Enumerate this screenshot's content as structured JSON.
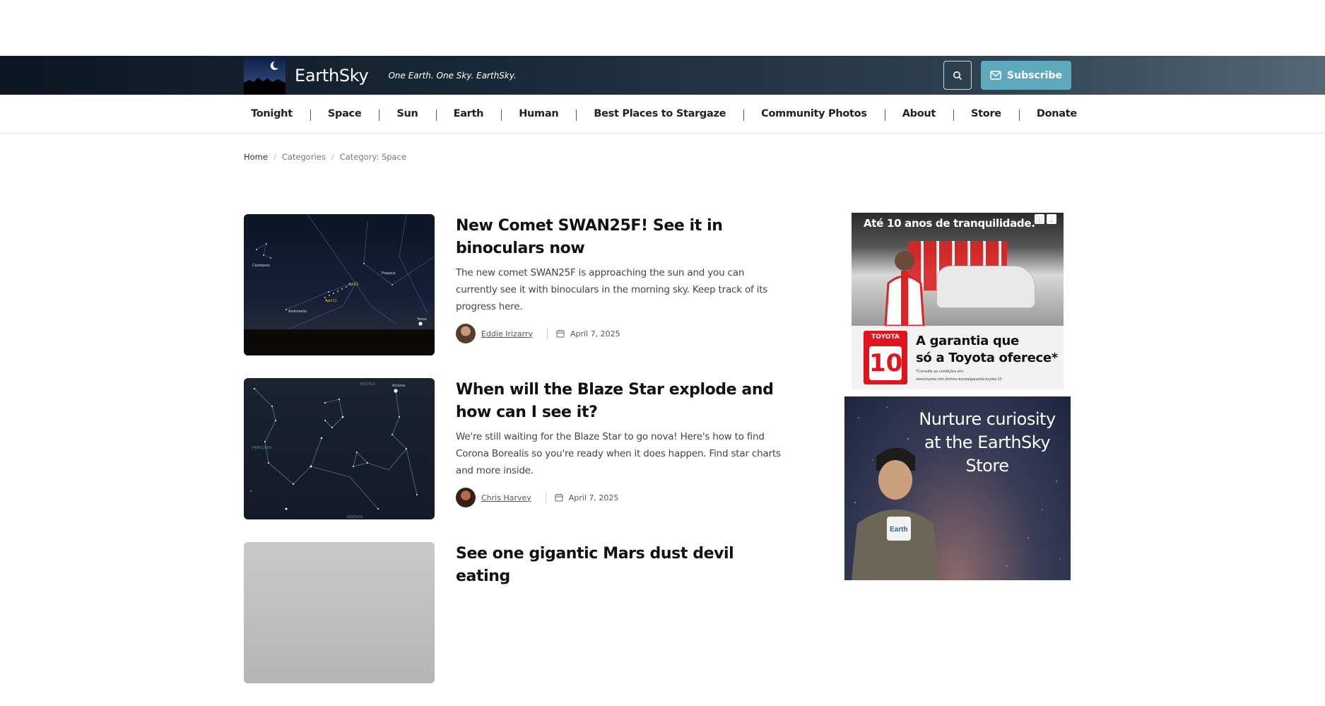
{
  "header": {
    "site_name": "EarthSky",
    "tagline": "One Earth. One Sky. EarthSky.",
    "subscribe_label": "Subscribe"
  },
  "nav": {
    "items": [
      "Tonight",
      "Space",
      "Sun",
      "Earth",
      "Human",
      "Best Places to Stargaze",
      "Community Photos",
      "About",
      "Store",
      "Donate"
    ]
  },
  "breadcrumb": {
    "home": "Home",
    "categories": "Categories",
    "current": "Category: Space"
  },
  "posts": [
    {
      "title": "New Comet SWAN25F! See it in binoculars now",
      "excerpt": "The new comet SWAN25F is approaching the sun and you can currently see it with binoculars in the morning sky. Keep track of its progress here.",
      "author": "Eddie Irizarry",
      "date": "April 7, 2025"
    },
    {
      "title": "When will the Blaze Star explode and how can I see it?",
      "excerpt": "We're still waiting for the Blaze Star to go nova! Here's how to find Corona Borealis so you're ready when it does happen. Find star charts and more inside.",
      "author": "Chris Harvey",
      "date": "April 7, 2025"
    },
    {
      "title": "See one gigantic Mars dust devil eating",
      "excerpt": "",
      "author": "",
      "date": ""
    }
  ],
  "thumb1_labels": {
    "cassiopeia": "Cassiopeia",
    "pegasus": "Pegasus",
    "andromeda": "Andromeda",
    "april6": "April 6",
    "april11": "April 11",
    "venus": "Venus"
  },
  "thumb2_labels": {
    "bootes": "BOOTES",
    "arcturus": "Arcturus",
    "hercules": "HERCULES",
    "serpens": "SERPENS"
  },
  "ads": {
    "toyota": {
      "headline": "Até 10 anos de tranquilidade.",
      "brand": "TOYOTA",
      "years": "10",
      "copy_line1": "A garantia que",
      "copy_line2": "só a Toyota oferece*",
      "fine_print_1": "*Consulte as condições em:",
      "fine_print_2": "www.toyota.com.br/meu-toyota/garantia-toyota-10"
    },
    "store": {
      "text": "Nurture curiosity at the EarthSky Store",
      "mug_label": "Earth"
    }
  },
  "colors": {
    "subscribe": "#5fa9bd",
    "header_dark": "#0c1722"
  },
  "icons": {
    "search": "search-icon",
    "mail": "mail-icon",
    "calendar": "calendar-icon"
  }
}
